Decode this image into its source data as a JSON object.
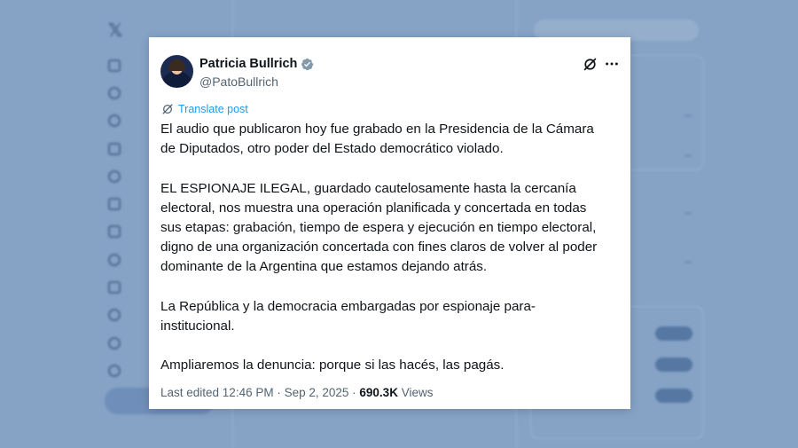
{
  "tweet": {
    "author_name": "Patricia Bullrich",
    "handle": "@PatoBullrich",
    "translate_label": "Translate post",
    "paragraphs": [
      "El audio que publicaron hoy fue grabado en la Presidencia de la Cámara\nde Diputados, otro poder del Estado democrático violado.",
      "EL ESPIONAJE ILEGAL, guardado cautelosamente hasta la cercanía\nelectoral, nos muestra una operación planificada y concertada en todas\nsus etapas: grabación, tiempo de espera y ejecución en tiempo electoral,\ndigno de una organización concertada con fines claros de volver al poder\ndominante de la Argentina que estamos dejando atrás.",
      "La República y la democracia embargadas por espionaje para-\ninstitucional.",
      "Ampliaremos la denuncia: porque si las hacés, las pagás."
    ],
    "edited_timestamp": "Last edited 12:46 PM · Sep 2, 2025 · ",
    "views_count": "690.3K",
    "views_label": " Views"
  },
  "icons": {
    "verified": "verified-badge-icon",
    "grok": "grok-icon",
    "more": "more-icon",
    "translate": "translate-icon"
  },
  "colors": {
    "background": "#86a3c6",
    "link": "#1d9bf0",
    "verified": "#829aab",
    "text": "#0f1419",
    "muted": "#536471"
  }
}
